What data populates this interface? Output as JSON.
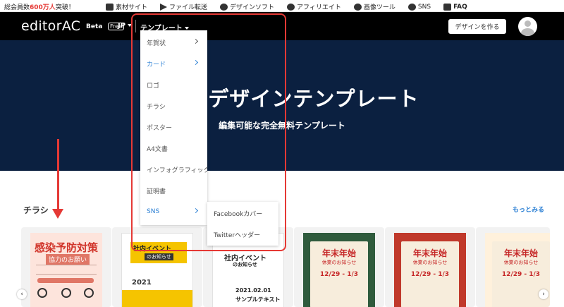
{
  "topbar": {
    "stat_prefix": "総会員数",
    "stat_number": "600万人",
    "stat_suffix": "突破！",
    "links": [
      {
        "label": "素材サイト",
        "icon": "image-icon"
      },
      {
        "label": "ファイル転送",
        "icon": "send-icon"
      },
      {
        "label": "デザインソフト",
        "icon": "design-icon"
      },
      {
        "label": "アフィリエイト",
        "icon": "affiliate-icon"
      },
      {
        "label": "画像ツール",
        "icon": "tools-icon"
      },
      {
        "label": "SNS",
        "icon": "sns-icon"
      },
      {
        "label": "FAQ",
        "icon": "faq-icon"
      }
    ]
  },
  "header": {
    "logo": "editorAC",
    "beta": "Beta",
    "free": "Free",
    "lang": "JP",
    "templates_menu": "テンプレート",
    "create_button": "デザインを作る"
  },
  "hero": {
    "title": "デザインテンプレート",
    "subtitle": "編集可能な完全無料テンプレート"
  },
  "dropdown": {
    "items": [
      {
        "label": "年賀状",
        "has_sub": true
      },
      {
        "label": "カード",
        "has_sub": true,
        "active": true
      },
      {
        "label": "ロゴ",
        "has_sub": false
      },
      {
        "label": "チラシ",
        "has_sub": false
      },
      {
        "label": "ポスター",
        "has_sub": false
      },
      {
        "label": "A4文書",
        "has_sub": false
      },
      {
        "label": "インフォグラフィック",
        "has_sub": false
      },
      {
        "label": "証明書",
        "has_sub": false
      },
      {
        "label": "SNS",
        "has_sub": true,
        "active": true
      }
    ],
    "submenu": [
      "Facebookカバー",
      "Twitterヘッダー"
    ]
  },
  "section": {
    "title": "チラシ",
    "more": "もっとみる"
  },
  "cards": {
    "c1": {
      "title": "感染予防対策",
      "sub": "協力のお願い"
    },
    "c2": {
      "title": "社内イベント",
      "sub": "のお知らせ",
      "date": "2021"
    },
    "c3": {
      "title": "社内イベント",
      "sub": "のお知らせ",
      "date": "2021.02.01",
      "text": "サンプルテキスト"
    },
    "c4": {
      "title": "年末年始",
      "sub": "休業のお知らせ",
      "date": "12/29 - 1/3"
    },
    "c5": {
      "title": "年末年始",
      "sub": "休業のお知らせ",
      "date": "12/29 - 1/3"
    },
    "c6": {
      "title": "年末年始",
      "sub": "休業のお知らせ",
      "date": "12/29 - 1/3"
    }
  },
  "colors": {
    "hero_bg": "#0b2040",
    "accent_blue": "#2a7fd4",
    "annotation_red": "#e53935"
  }
}
